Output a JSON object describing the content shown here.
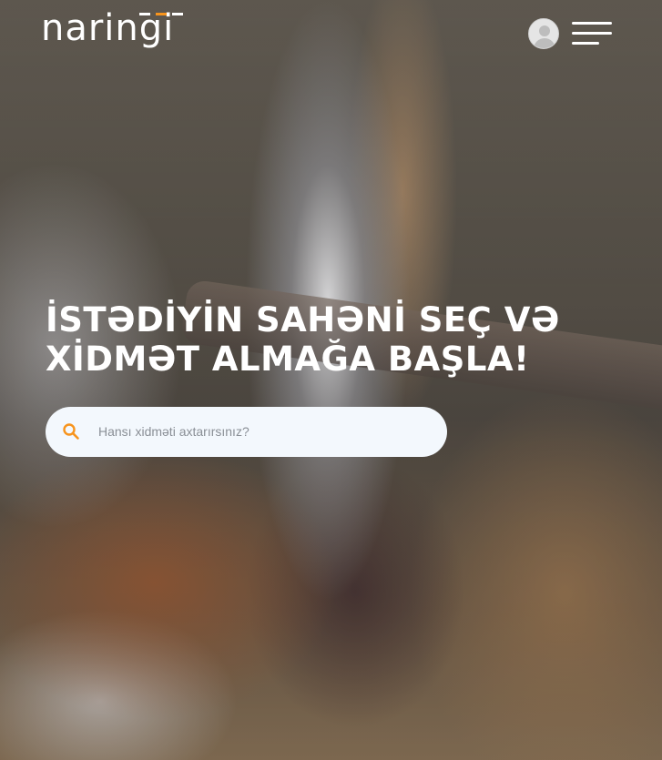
{
  "header": {
    "logo_text": "naringi",
    "menu_icon": "hamburger-menu-icon",
    "profile_icon": "user-avatar-icon"
  },
  "hero": {
    "headline_line1": "İSTƏDİYİN SAHƏNİ SEÇ VƏ",
    "headline_line2": "XİDMƏT ALMAĞA BAŞLA!"
  },
  "search": {
    "placeholder": "Hansı xidməti axtarırsınız?",
    "icon": "search-icon"
  },
  "colors": {
    "accent": "#f7941d",
    "search_bg": "#f3f8fd",
    "text_light": "#ffffff"
  }
}
